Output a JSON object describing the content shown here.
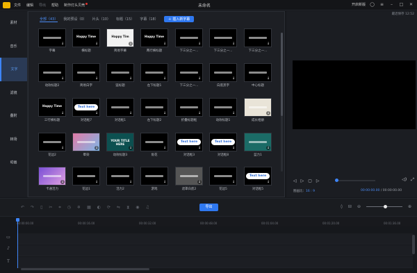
{
  "titlebar": {
    "menu": [
      "文件",
      "编辑",
      "导出",
      "帮助",
      "制作灯头贝壳"
    ],
    "doc_title": "未命名",
    "right": [
      "开启新版"
    ]
  },
  "sidebar": {
    "items": [
      {
        "label": "素材",
        "active": false
      },
      {
        "label": "音乐",
        "active": false
      },
      {
        "label": "文字",
        "active": true
      },
      {
        "label": "滤镜",
        "active": false
      },
      {
        "label": "叠附",
        "active": false
      },
      {
        "label": "转场",
        "active": false
      },
      {
        "label": "动画",
        "active": false
      }
    ]
  },
  "tabs": [
    {
      "label": "全部（43）",
      "active": true
    },
    {
      "label": "我的预设（0）",
      "active": false
    },
    {
      "label": "片头（10）",
      "active": false
    },
    {
      "label": "标题（15）",
      "active": false
    },
    {
      "label": "字幕（18）",
      "active": false
    }
  ],
  "new_button": "插入新字幕",
  "tiles": [
    {
      "label": "字幕",
      "thumb_text": ""
    },
    {
      "label": "横标题",
      "thumb_text": "Happy Time"
    },
    {
      "label": "简易字幕",
      "thumb_text": "Happy Tim"
    },
    {
      "label": "两行横标题",
      "thumb_text": "Happy Time"
    },
    {
      "label": "下三分之一...",
      "thumb_text": ""
    },
    {
      "label": "下三分之一...",
      "thumb_text": ""
    },
    {
      "label": "下三分之一...",
      "thumb_text": ""
    },
    {
      "label": "动效标题2",
      "thumb_text": ""
    },
    {
      "label": "简易白字",
      "thumb_text": ""
    },
    {
      "label": "竖标题",
      "thumb_text": ""
    },
    {
      "label": "左下标题1",
      "thumb_text": ""
    },
    {
      "label": "下三分之一...",
      "thumb_text": ""
    },
    {
      "label": "白底黑字",
      "thumb_text": ""
    },
    {
      "label": "中心标题",
      "thumb_text": ""
    },
    {
      "label": "三行横标题",
      "thumb_text": "Happy Time"
    },
    {
      "label": "对话框7",
      "thumb_text": "Text here"
    },
    {
      "label": "对话框1",
      "thumb_text": ""
    },
    {
      "label": "左下标题2",
      "thumb_text": ""
    },
    {
      "label": "折叠标题框",
      "thumb_text": ""
    },
    {
      "label": "动效标题1",
      "thumb_text": ""
    },
    {
      "label": "成长相册",
      "thumb_text": ""
    },
    {
      "label": "花边2",
      "thumb_text": ""
    },
    {
      "label": "晕染",
      "thumb_text": ""
    },
    {
      "label": "动效标题3",
      "thumb_text": "YOUR TITLE HERE"
    },
    {
      "label": "角花",
      "thumb_text": ""
    },
    {
      "label": "对话框3",
      "thumb_text": "Text here"
    },
    {
      "label": "对话框8",
      "thumb_text": "Text here"
    },
    {
      "label": "蓝力1",
      "thumb_text": ""
    },
    {
      "label": "卡通活力",
      "thumb_text": ""
    },
    {
      "label": "花边1",
      "thumb_text": ""
    },
    {
      "label": "活力2",
      "thumb_text": ""
    },
    {
      "label": "游戏",
      "thumb_text": ""
    },
    {
      "label": "遮罩白底2",
      "thumb_text": ""
    },
    {
      "label": "花边5",
      "thumb_text": ""
    },
    {
      "label": "对话框5",
      "thumb_text": "Text here"
    }
  ],
  "preview": {
    "autosave": "最近保存 12:52",
    "ratio_label": "图画比：",
    "ratio_value": "16 : 9",
    "time_current": "00:00:00.00",
    "time_total": "/ 00:00:00.00"
  },
  "toolbar": {
    "export_label": "导出"
  },
  "ruler": {
    "ticks": [
      "00:00:00.00",
      "00:00:16.00",
      "00:00:32.00",
      "00:00:48.00",
      "00:01:04.00",
      "00:01:20.00",
      "00:01:36.00"
    ]
  }
}
